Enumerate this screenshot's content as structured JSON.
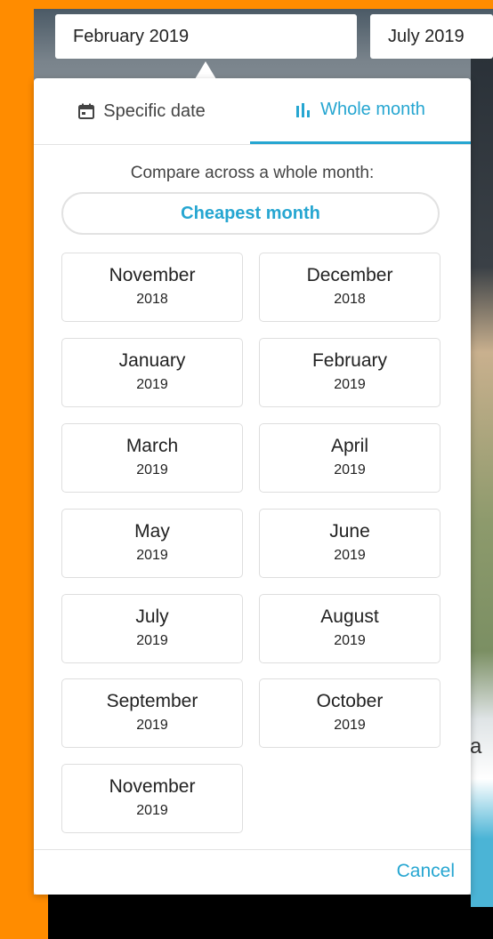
{
  "search": {
    "depart_date": "February 2019",
    "return_date": "July 2019"
  },
  "background": {
    "peek_text": "a"
  },
  "tabs": [
    {
      "label": "Specific date",
      "icon": "calendar-icon",
      "active": false
    },
    {
      "label": "Whole month",
      "icon": "bar-chart-icon",
      "active": true
    }
  ],
  "compare": {
    "text": "Compare across a whole month:",
    "cheapest_label": "Cheapest month"
  },
  "months": [
    {
      "name": "November",
      "year": "2018"
    },
    {
      "name": "December",
      "year": "2018"
    },
    {
      "name": "January",
      "year": "2019"
    },
    {
      "name": "February",
      "year": "2019"
    },
    {
      "name": "March",
      "year": "2019"
    },
    {
      "name": "April",
      "year": "2019"
    },
    {
      "name": "May",
      "year": "2019"
    },
    {
      "name": "June",
      "year": "2019"
    },
    {
      "name": "July",
      "year": "2019"
    },
    {
      "name": "August",
      "year": "2019"
    },
    {
      "name": "September",
      "year": "2019"
    },
    {
      "name": "October",
      "year": "2019"
    },
    {
      "name": "November",
      "year": "2019"
    }
  ],
  "footer": {
    "cancel_label": "Cancel"
  },
  "colors": {
    "accent": "#26a6d1",
    "orange": "#ff8c00"
  }
}
